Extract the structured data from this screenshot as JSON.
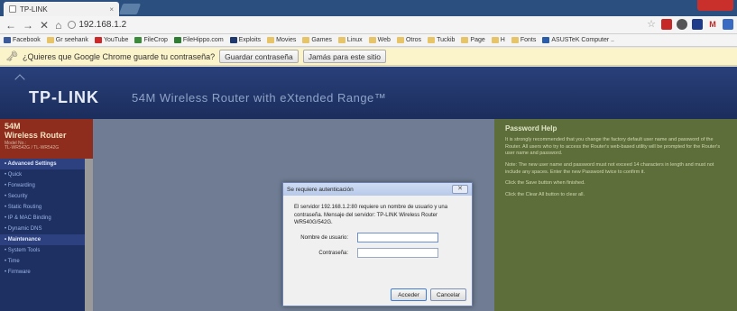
{
  "browser": {
    "tab_title": "TP-LINK",
    "tab_close": "×",
    "url": "192.168.1.2",
    "nav": {
      "back": "←",
      "forward": "→",
      "stop": "✕",
      "home": "⌂"
    },
    "toolbar_icons": [
      "star-icon",
      "gmail-badge-icon",
      "chrome-web-store-icon",
      "evernote-icon",
      "gmail-icon",
      "extension-icon"
    ]
  },
  "bookmarks": [
    {
      "label": "Facebook",
      "icon": "facebook-icon",
      "color": "#3b5998"
    },
    {
      "label": "Gr seehank",
      "icon": "folder-icon",
      "color": "#e8c469"
    },
    {
      "label": "YouTube",
      "icon": "youtube-icon",
      "color": "#cc2a2a"
    },
    {
      "label": "FileCrop",
      "icon": "filecrop-icon",
      "color": "#3b8b3b"
    },
    {
      "label": "FileHippo.com",
      "icon": "filehippo-icon",
      "color": "#2e7d32"
    },
    {
      "label": "Exploits",
      "icon": "exploit-icon",
      "color": "#1e3a6e"
    },
    {
      "label": "Movies",
      "icon": "folder-icon",
      "color": "#e8c469"
    },
    {
      "label": "Games",
      "icon": "folder-icon",
      "color": "#e8c469"
    },
    {
      "label": "Linux",
      "icon": "folder-icon",
      "color": "#e8c469"
    },
    {
      "label": "Web",
      "icon": "folder-icon",
      "color": "#e8c469"
    },
    {
      "label": "Otros",
      "icon": "folder-icon",
      "color": "#e8c469"
    },
    {
      "label": "Tuckib",
      "icon": "folder-icon",
      "color": "#e8c469"
    },
    {
      "label": "Page",
      "icon": "folder-icon",
      "color": "#e8c469"
    },
    {
      "label": "H",
      "icon": "folder-icon",
      "color": "#e8c469"
    },
    {
      "label": "Fonts",
      "icon": "folder-icon",
      "color": "#e8c469"
    },
    {
      "label": "ASUSTeK Computer ..",
      "icon": "asus-icon",
      "color": "#2a5caa"
    }
  ],
  "password_bar": {
    "message": "¿Quieres que Google Chrome guarde tu contraseña?",
    "save_label": "Guardar contraseña",
    "never_label": "Jamás para este sitio"
  },
  "router": {
    "logo": "TP-LINK",
    "tagline": "54M Wireless Router with eXtended Range™",
    "sidebar": {
      "line1": "54M",
      "line2": "Wireless Router",
      "model_line1": "Model No.:",
      "model_line2": "TL-WR542G / TL-WR542G",
      "items": [
        {
          "label": "• Advanced Settings",
          "head": true
        },
        {
          "label": "• Quick",
          "head": false
        },
        {
          "label": "• Forwarding",
          "head": false
        },
        {
          "label": "• Security",
          "head": false
        },
        {
          "label": "• Static Routing",
          "head": false
        },
        {
          "label": "• IP & MAC Binding",
          "head": false
        },
        {
          "label": "• Dynamic DNS",
          "head": false
        },
        {
          "label": "• Maintenance",
          "head": true
        },
        {
          "label": "• System Tools",
          "head": false
        },
        {
          "label": "• Time",
          "head": false
        },
        {
          "label": "• Firmware",
          "head": false
        }
      ]
    },
    "help": {
      "title": "Password Help",
      "paragraphs": [
        "It is strongly recommended that you change the factory default user name and password of the Router. All users who try to access the Router's web-based utility will be prompted for the Router's user name and password.",
        "Note: The new user name and password must not exceed 14 characters in length and must not include any spaces. Enter the new Password twice to confirm it.",
        "Click the Save button when finished.",
        "Click the Clear All button to clear all."
      ]
    }
  },
  "auth_dialog": {
    "title": "Se requiere autenticación",
    "close": "✕",
    "message": "El servidor 192.168.1.2:80 requiere un nombre de usuario y una contraseña. Mensaje del servidor: TP-LINK Wireless Router WR540G/542G.",
    "username_label": "Nombre de usuario:",
    "password_label": "Contraseña:",
    "username_value": "",
    "password_value": "",
    "accept_label": "Acceder",
    "cancel_label": "Cancelar"
  }
}
